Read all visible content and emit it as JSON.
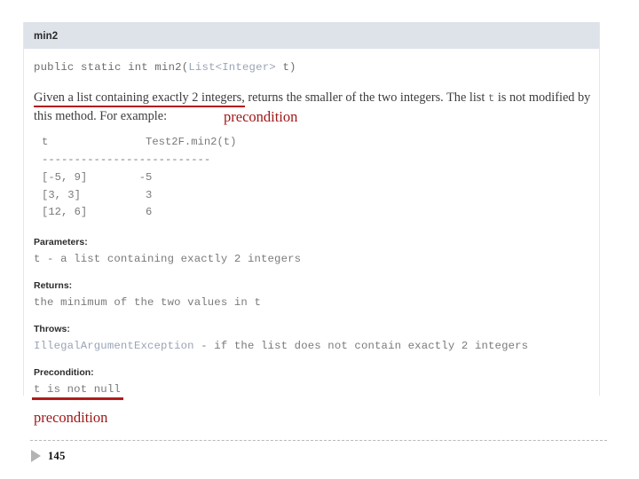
{
  "slide": {
    "page_number": "145",
    "marker_icon": "triangle-right-icon",
    "accent_red": "#b01b1b",
    "annotation_red": "#a01818",
    "header_bg": "#dee3ea",
    "link_color": "#9aa4b5"
  },
  "doc": {
    "header_title": "min2",
    "signature": {
      "prefix": "public static int min2(",
      "type": "List<Integer>",
      "suffix": " t)"
    },
    "description": {
      "underlined_clause": "Given a list containing exactly 2 integers,",
      "rest_before_mono": " returns the smaller of the two integers. The list ",
      "mono_token": "t",
      "rest_after_mono": " is not modified by this method. For example:"
    },
    "example": {
      "header": "t               Test2F.min2(t)",
      "divider": "--------------------------",
      "rows": [
        "[-5, 9]        -5",
        "[3, 3]          3",
        "[12, 6]         6"
      ]
    },
    "sections": [
      {
        "label": "Parameters:",
        "text": "t - a list containing exactly 2 integers"
      },
      {
        "label": "Returns:",
        "text": "the minimum of the two values in t"
      },
      {
        "label": "Throws:",
        "exception": "IllegalArgumentException",
        "text": " - if the list does not contain exactly 2 integers"
      },
      {
        "label": "Precondition:",
        "text": "t is not null"
      }
    ]
  },
  "annotations": {
    "top": "precondition",
    "bottom": "precondition"
  }
}
